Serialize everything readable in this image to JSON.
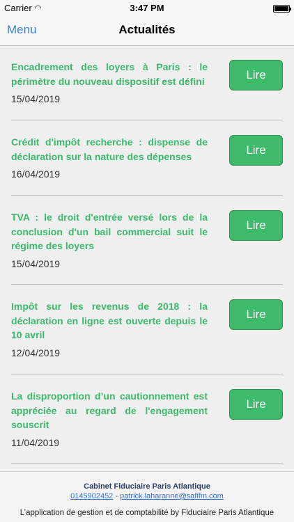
{
  "status_bar": {
    "carrier": "Carrier",
    "time": "3:47 PM"
  },
  "nav": {
    "menu_label": "Menu",
    "title": "Actualités"
  },
  "articles": [
    {
      "title": "Encadrement des loyers à Paris : le périmètre du nouveau dispositif est défini",
      "date": "15/04/2019",
      "button": "Lire"
    },
    {
      "title": "Crédit d'impôt recherche : dispense de déclaration sur la nature des dépenses",
      "date": "16/04/2019",
      "button": "Lire"
    },
    {
      "title": "TVA : le droit d'entrée versé lors de la conclusion d'un bail commercial suit le régime des loyers",
      "date": "15/04/2019",
      "button": "Lire"
    },
    {
      "title": "Impôt sur les revenus de 2018 : la déclaration en ligne est ouverte depuis le 10 avril",
      "date": "12/04/2019",
      "button": "Lire"
    },
    {
      "title": "La disproportion d’un cautionnement est appréciée au regard de l'engagement souscrit",
      "date": "11/04/2019",
      "button": "Lire"
    }
  ],
  "footer": {
    "company": "Cabinet Fiduciaire Paris Atlantique",
    "phone": "0145902452",
    "separator": " - ",
    "email": "patrick.laharanne@safifm.com",
    "tagline": "L’application de gestion et de comptabilité by Fiduciaire Paris Atlantique"
  }
}
